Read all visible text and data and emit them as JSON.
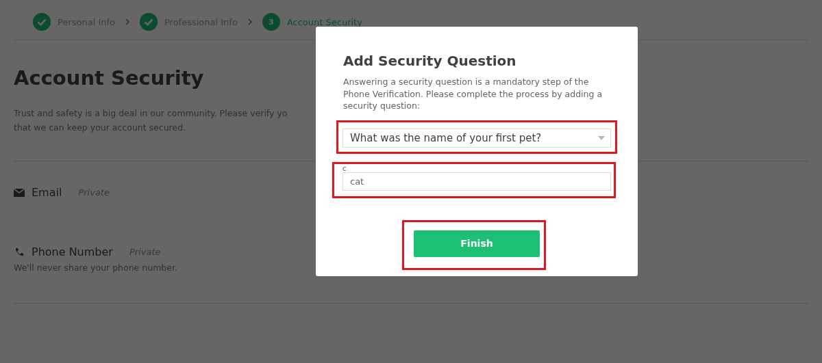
{
  "steps": [
    {
      "label": "Personal Info",
      "done": true,
      "current": false
    },
    {
      "label": "Professional Info",
      "done": true,
      "current": false
    },
    {
      "label": "Account Security",
      "done": false,
      "current": true,
      "number": "3"
    }
  ],
  "page": {
    "title": "Account Security",
    "intro": "Trust and safety is a big deal in our community. Please verify yo",
    "intro_line2": "that we can keep your account secured.",
    "sections": [
      {
        "kind": "email",
        "label": "Email",
        "privacy": "Private"
      },
      {
        "kind": "phone",
        "label": "Phone Number",
        "privacy": "Private",
        "hint": "We'll never share your phone number."
      }
    ]
  },
  "dialog": {
    "title": "Add Security Question",
    "description": "Answering a security question is a mandatory step of the Phone Verification. Please complete the process by adding a security question:",
    "question_select": {
      "value": "What was the name of your first pet?",
      "highlighted": true
    },
    "answer_field": {
      "label": "c",
      "value": "cat",
      "highlighted": true
    },
    "finish_button": {
      "label": "Finish",
      "highlighted": true
    }
  }
}
